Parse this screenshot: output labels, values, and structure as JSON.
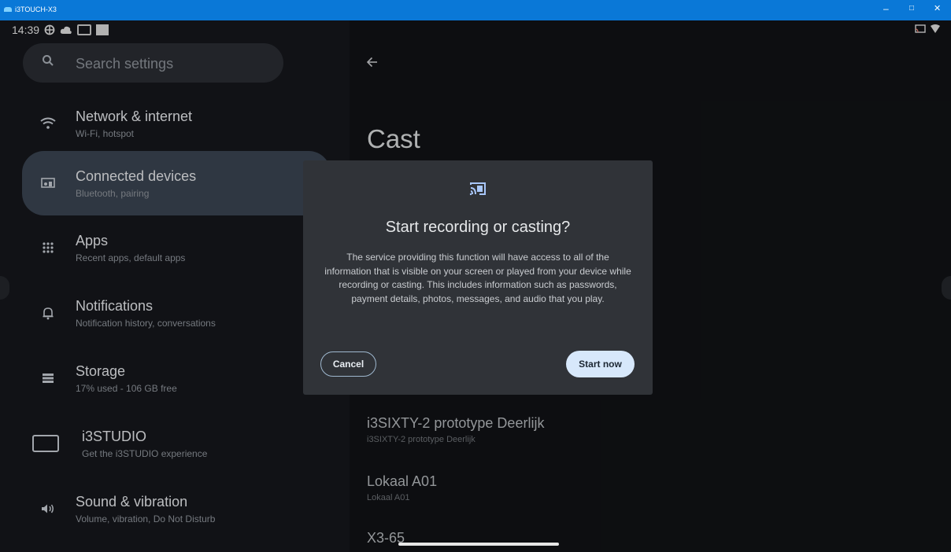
{
  "window": {
    "title": "i3TOUCH-X3",
    "minimize": "–",
    "maximize": "□",
    "close": "✕"
  },
  "status_bar": {
    "time": "14:39"
  },
  "sidebar": {
    "search_placeholder": "Search settings",
    "items": [
      {
        "title": "Network & internet",
        "subtitle": "Wi-Fi, hotspot",
        "icon": "wifi-icon"
      },
      {
        "title": "Connected devices",
        "subtitle": "Bluetooth, pairing",
        "icon": "connected-devices-icon",
        "active": true
      },
      {
        "title": "Apps",
        "subtitle": "Recent apps, default apps",
        "icon": "apps-grid-icon"
      },
      {
        "title": "Notifications",
        "subtitle": "Notification history, conversations",
        "icon": "bell-icon"
      },
      {
        "title": "Storage",
        "subtitle": "17% used - 106 GB free",
        "icon": "storage-icon"
      },
      {
        "title": "i3STUDIO",
        "subtitle": "Get the i3STUDIO experience",
        "icon": "monitor-icon"
      },
      {
        "title": "Sound & vibration",
        "subtitle": "Volume, vibration, Do Not Disturb",
        "icon": "speaker-icon"
      }
    ]
  },
  "main": {
    "title": "Cast",
    "devices": [
      {
        "title": "i3SIXTY-2 prototype Deerlijk",
        "subtitle": "i3SIXTY-2 prototype Deerlijk"
      },
      {
        "title": "Lokaal A01",
        "subtitle": "Lokaal A01"
      },
      {
        "title": "X3-65",
        "subtitle": ""
      }
    ]
  },
  "dialog": {
    "icon": "cast-icon",
    "title": "Start recording or casting?",
    "body": "The service providing this function will have access to all of the information that is visible on your screen or played from your device while recording or casting. This includes information such as passwords, payment details, photos, messages, and audio that you play.",
    "cancel_label": "Cancel",
    "start_label": "Start now"
  },
  "colors": {
    "titlebar": "#0a78d7",
    "active_item": "#3a4451",
    "dialog_bg": "#303338",
    "primary_button": "#d7e8fb",
    "accent_icon": "#a8c7fa"
  }
}
